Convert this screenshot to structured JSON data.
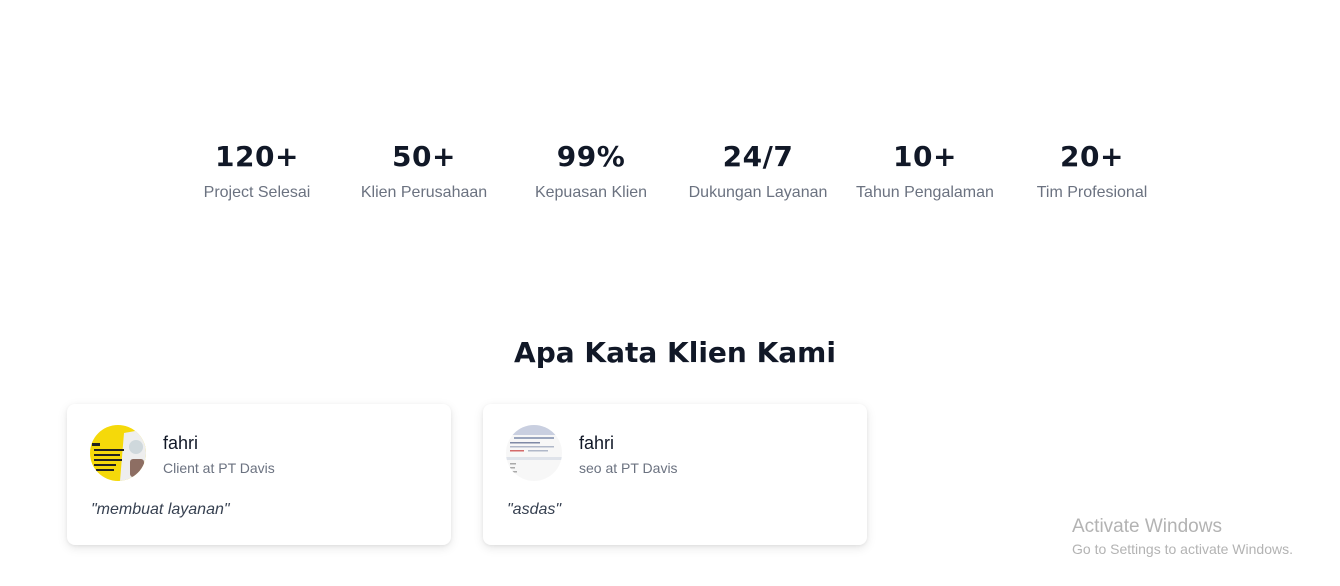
{
  "stats": [
    {
      "value": "120+",
      "label": "Project Selesai"
    },
    {
      "value": "50+",
      "label": "Klien Perusahaan"
    },
    {
      "value": "99%",
      "label": "Kepuasan Klien"
    },
    {
      "value": "24/7",
      "label": "Dukungan Layanan"
    },
    {
      "value": "10+",
      "label": "Tahun Pengalaman"
    },
    {
      "value": "20+",
      "label": "Tim Profesional"
    }
  ],
  "testimonials": {
    "title": "Apa Kata Klien Kami",
    "items": [
      {
        "name": "fahri",
        "role": "Client at PT Davis",
        "quote": "\"membuat layanan\"",
        "avatar": "avatar-photo-yellow"
      },
      {
        "name": "fahri",
        "role": "seo at PT Davis",
        "quote": "\"asdas\"",
        "avatar": "avatar-photo-screenshot"
      }
    ]
  },
  "watermark": {
    "title": "Activate Windows",
    "subtitle": "Go to Settings to activate Windows."
  },
  "colors": {
    "heading": "#111827",
    "muted": "#6b7280",
    "avatar_accent": "#f5d90a",
    "watermark": "#b3b3b3"
  }
}
